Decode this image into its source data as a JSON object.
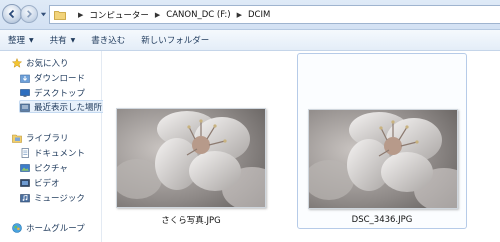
{
  "address": {
    "crumbs": [
      "コンピューター",
      "CANON_DC (F:)",
      "DCIM"
    ]
  },
  "toolbar": {
    "organize": "整理",
    "share": "共有",
    "burn": "書き込む",
    "new_folder": "新しいフォルダー"
  },
  "nav": {
    "favorites": "お気に入り",
    "downloads": "ダウンロード",
    "desktop": "デスクトップ",
    "recent": "最近表示した場所",
    "libraries": "ライブラリ",
    "documents": "ドキュメント",
    "pictures": "ピクチャ",
    "videos": "ビデオ",
    "music": "ミュージック",
    "homegroup": "ホームグループ"
  },
  "files": [
    {
      "name": "さくら写真.JPG"
    },
    {
      "name": "DSC_3436.JPG"
    }
  ]
}
